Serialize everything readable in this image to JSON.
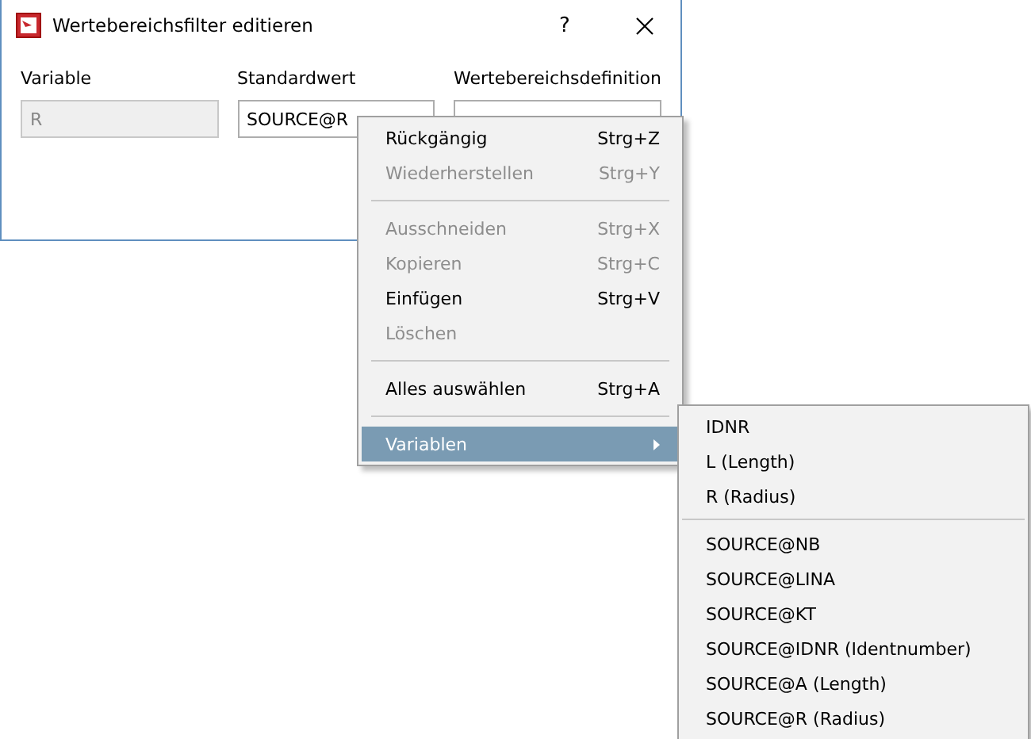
{
  "window": {
    "title": "Wertebereichsfilter editieren",
    "help": "?"
  },
  "fields": [
    {
      "label": "Variable",
      "value": "R",
      "disabled": true
    },
    {
      "label": "Standardwert",
      "value": "SOURCE@R",
      "disabled": false
    },
    {
      "label": "Wertebereichsdefinition",
      "disabled": false
    }
  ],
  "context_menu": [
    {
      "kind": "item",
      "label": "Rückgängig",
      "shortcut": "Strg+Z",
      "disabled": false,
      "selected": false
    },
    {
      "kind": "item",
      "label": "Wiederherstellen",
      "shortcut": "Strg+Y",
      "disabled": true,
      "selected": false
    },
    {
      "kind": "separator"
    },
    {
      "kind": "item",
      "label": "Ausschneiden",
      "shortcut": "Strg+X",
      "disabled": true,
      "selected": false
    },
    {
      "kind": "item",
      "label": "Kopieren",
      "shortcut": "Strg+C",
      "disabled": true,
      "selected": false
    },
    {
      "kind": "item",
      "label": "Einfügen",
      "shortcut": "Strg+V",
      "disabled": false,
      "selected": false
    },
    {
      "kind": "item",
      "label": "Löschen",
      "disabled": true,
      "selected": false
    },
    {
      "kind": "separator"
    },
    {
      "kind": "item",
      "label": "Alles auswählen",
      "shortcut": "Strg+A",
      "disabled": false,
      "selected": false
    },
    {
      "kind": "separator"
    },
    {
      "kind": "submenu",
      "label": "Variablen",
      "disabled": false,
      "selected": true
    }
  ],
  "submenu": [
    {
      "kind": "item",
      "label": "IDNR"
    },
    {
      "kind": "item",
      "label": "L (Length)"
    },
    {
      "kind": "item",
      "label": "R (Radius)"
    },
    {
      "kind": "separator"
    },
    {
      "kind": "item",
      "label": "SOURCE@NB"
    },
    {
      "kind": "item",
      "label": "SOURCE@LINA"
    },
    {
      "kind": "item",
      "label": "SOURCE@KT"
    },
    {
      "kind": "item",
      "label": "SOURCE@IDNR (Identnumber)"
    },
    {
      "kind": "item",
      "label": "SOURCE@A (Length)"
    },
    {
      "kind": "item",
      "label": "SOURCE@R (Radius)"
    }
  ]
}
